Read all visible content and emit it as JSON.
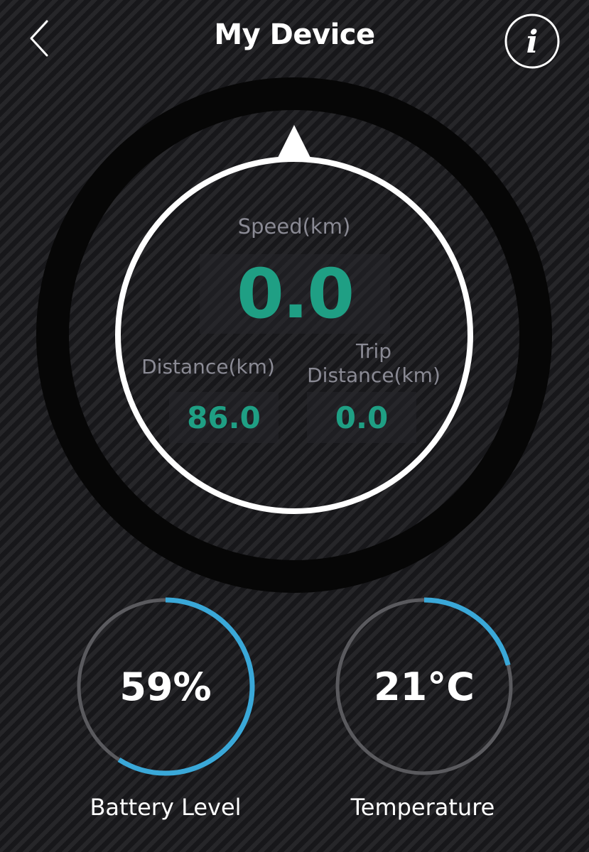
{
  "header": {
    "title": "My Device",
    "back_icon": "chevron-left-icon",
    "info_icon": "info-icon"
  },
  "speedometer": {
    "speed_label": "Speed(km)",
    "speed_value": "0.0",
    "distance_label": "Distance(km)",
    "distance_value": "86.0",
    "trip_label_line1": "Trip",
    "trip_label_line2": "Distance(km)",
    "trip_value": "0.0"
  },
  "gauges": {
    "battery": {
      "value_text": "59%",
      "label": "Battery Level",
      "fraction": 0.59
    },
    "temperature": {
      "value_text": "21°C",
      "label": "Temperature",
      "fraction": 0.21
    }
  },
  "colors": {
    "accent_green": "#1f9f84",
    "gauge_blue": "#3aa8d8",
    "gauge_track": "#5a5a5e",
    "label_gray": "#8a8a94"
  }
}
